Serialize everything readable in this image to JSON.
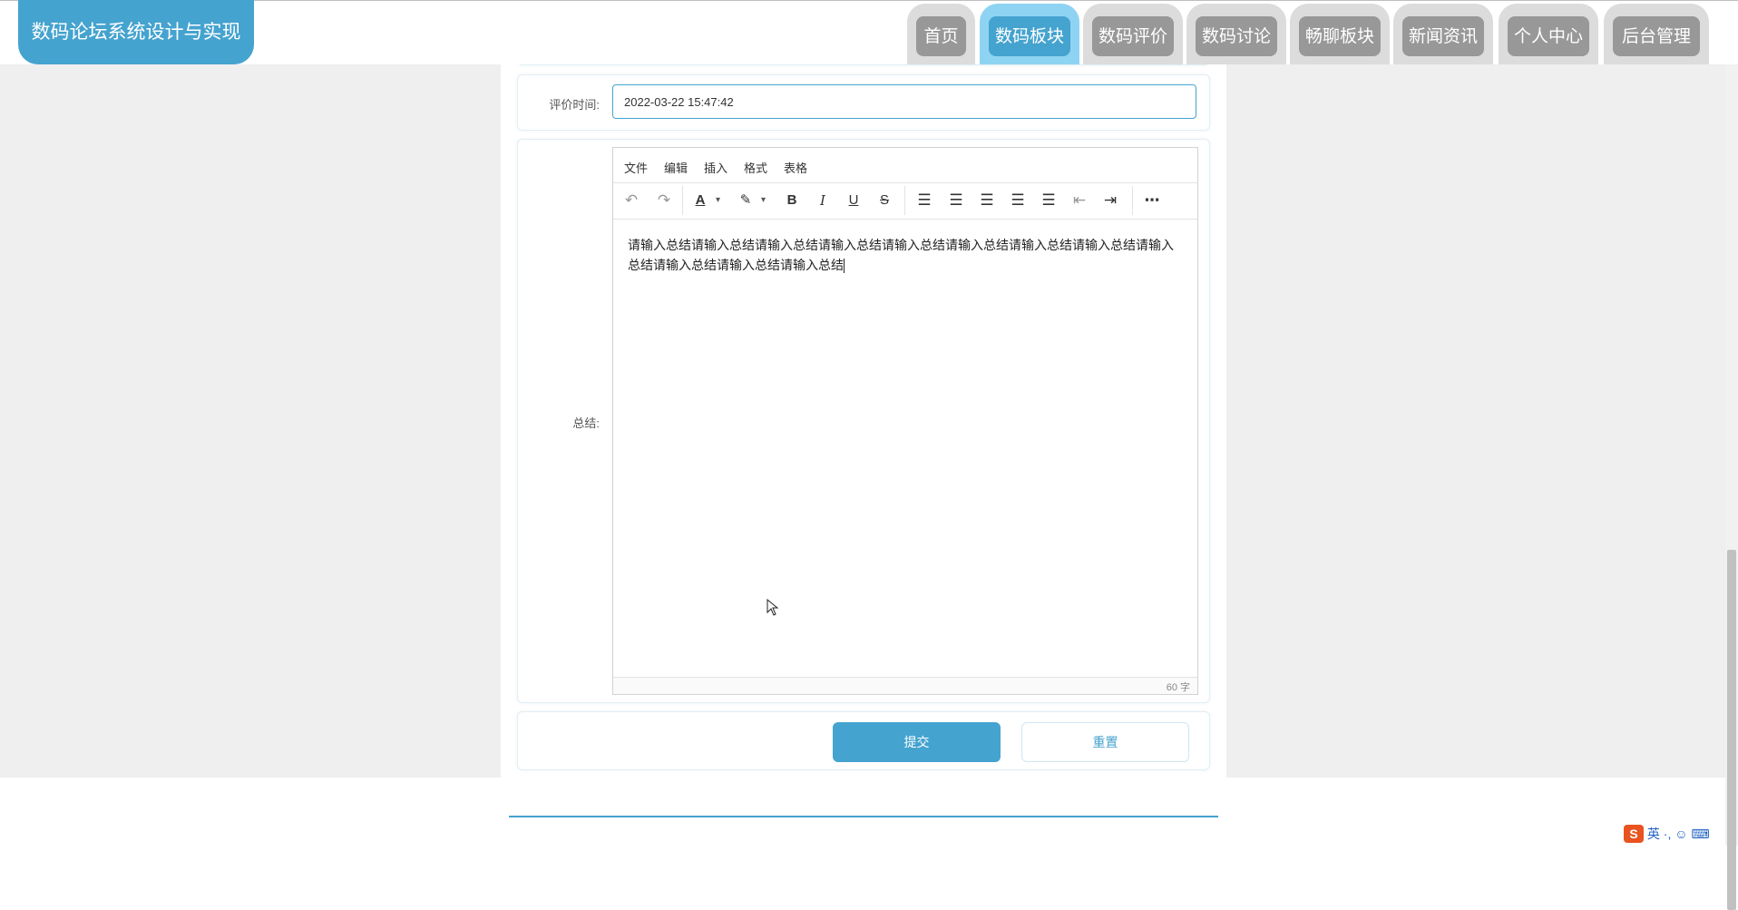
{
  "header": {
    "site_title": "数码论坛系统设计与实现",
    "nav": [
      {
        "label": "首页",
        "active": false
      },
      {
        "label": "数码板块",
        "active": true
      },
      {
        "label": "数码评价",
        "active": false
      },
      {
        "label": "数码讨论",
        "active": false
      },
      {
        "label": "畅聊板块",
        "active": false
      },
      {
        "label": "新闻资讯",
        "active": false
      },
      {
        "label": "个人中心",
        "active": false
      },
      {
        "label": "后台管理",
        "active": false
      }
    ]
  },
  "form": {
    "time_label": "评价时间:",
    "time_value": "2022-03-22 15:47:42",
    "summary_label": "总结:",
    "editor": {
      "menu": [
        "文件",
        "编辑",
        "插入",
        "格式",
        "表格"
      ],
      "toolbar_icons": [
        "undo-icon",
        "redo-icon",
        "text-color-icon",
        "highlight-icon",
        "bold-icon",
        "italic-icon",
        "underline-icon",
        "strikethrough-icon",
        "line-height-icon",
        "align-left-icon",
        "align-center-icon",
        "align-right-icon",
        "align-justify-icon",
        "outdent-icon",
        "indent-icon",
        "more-icon"
      ],
      "content": "请输入总结请输入总结请输入总结请输入总结请输入总结请输入总结请输入总结请输入总结请输入总结请输入总结请输入总结请输入总结",
      "word_count": "60 字"
    },
    "submit_label": "提交",
    "reset_label": "重置"
  },
  "ime": {
    "label": "英 ·, ☺ ⌨"
  },
  "colors": {
    "accent": "#45a3cf",
    "nav_bg": "#989898",
    "nav_outer": "#dcdcdc",
    "page_bg": "#efefef"
  }
}
